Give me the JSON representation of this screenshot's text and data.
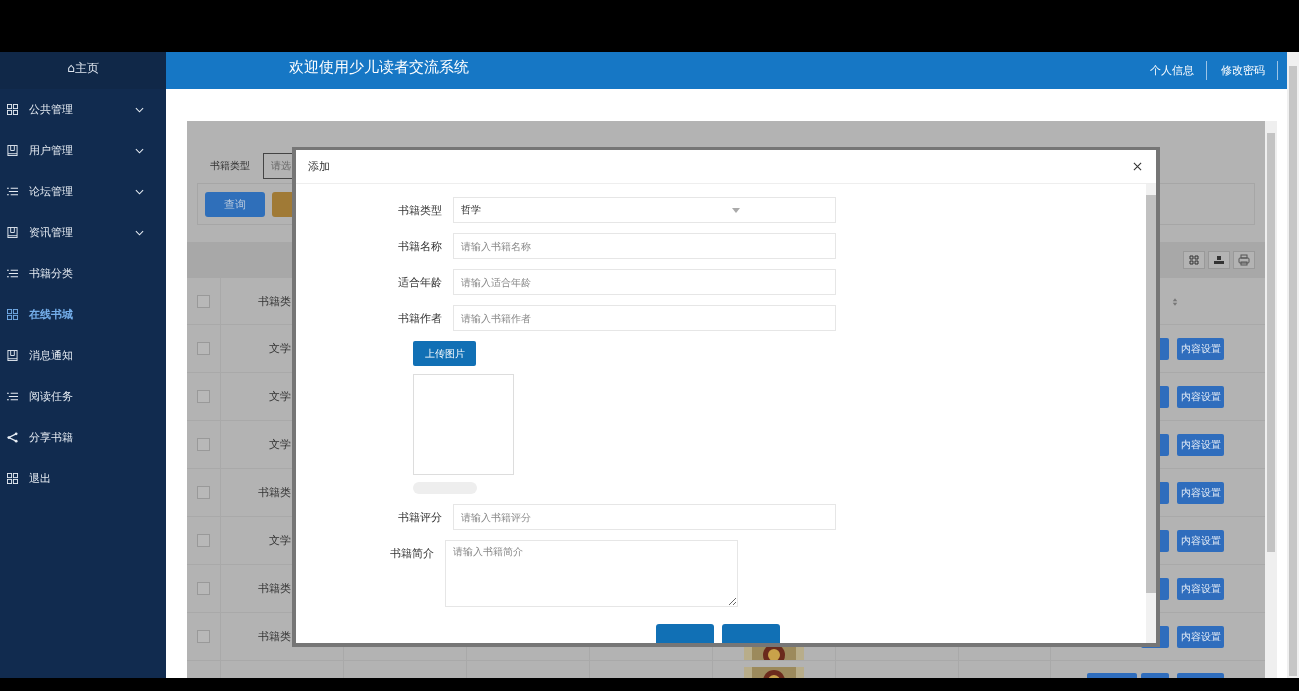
{
  "sidebar": {
    "home": "⌂主页",
    "items": [
      {
        "label": "公共管理",
        "kind": "grid",
        "has_submenu": true,
        "selected": false
      },
      {
        "label": "用户管理",
        "kind": "book",
        "has_submenu": true,
        "selected": false
      },
      {
        "label": "论坛管理",
        "kind": "list",
        "has_submenu": true,
        "selected": false
      },
      {
        "label": "资讯管理",
        "kind": "book",
        "has_submenu": true,
        "selected": false
      },
      {
        "label": "书籍分类",
        "kind": "list",
        "has_submenu": false,
        "selected": false
      },
      {
        "label": "在线书城",
        "kind": "grid",
        "has_submenu": false,
        "selected": true
      },
      {
        "label": "消息通知",
        "kind": "book",
        "has_submenu": false,
        "selected": false
      },
      {
        "label": "阅读任务",
        "kind": "list",
        "has_submenu": false,
        "selected": false
      },
      {
        "label": "分享书籍",
        "kind": "share",
        "has_submenu": false,
        "selected": false
      },
      {
        "label": "退出",
        "kind": "grid",
        "has_submenu": false,
        "selected": false
      }
    ]
  },
  "header": {
    "title": "欢迎使用少儿读者交流系统",
    "links": [
      "个人信息",
      "修改密码"
    ]
  },
  "search": {
    "label": "书籍类型",
    "placeholder": "请选",
    "query_button": "查询"
  },
  "table": {
    "columns": [
      "书籍类"
    ],
    "select_all": {
      "checked": false
    },
    "rows": [
      {
        "type": "文学",
        "action": "内容设置",
        "cover": null,
        "checked": false
      },
      {
        "type": "文学",
        "action": "内容设置",
        "cover": null,
        "checked": false
      },
      {
        "type": "文学",
        "action": "内容设置",
        "cover": null,
        "checked": false
      },
      {
        "type": "书籍类",
        "action": "内容设置",
        "cover": null,
        "checked": false
      },
      {
        "type": "文学",
        "action": "内容设置",
        "cover": null,
        "checked": false
      },
      {
        "type": "书籍类",
        "action": "内容设置",
        "cover": null,
        "checked": false
      },
      {
        "type": "书籍类",
        "action": "内容设置",
        "cover": {
          "kind": "picture"
        },
        "checked": false
      },
      {
        "cover": {
          "kind": "picture"
        }
      }
    ]
  },
  "modal": {
    "title": "添加",
    "fields": [
      {
        "label": "书籍类型",
        "kind": "select",
        "value": "哲学"
      },
      {
        "label": "书籍名称",
        "kind": "text",
        "placeholder": "请输入书籍名称"
      },
      {
        "label": "适合年龄",
        "kind": "text",
        "placeholder": "请输入适合年龄"
      },
      {
        "label": "书籍作者",
        "kind": "text",
        "placeholder": "请输入书籍作者"
      },
      {
        "kind": "upload",
        "button": "上传图片",
        "level": 0
      },
      {
        "label": "书籍评分",
        "kind": "text",
        "placeholder": "请输入书籍评分"
      },
      {
        "label": "书籍简介",
        "kind": "textarea",
        "placeholder": "请输入书籍简介"
      }
    ]
  }
}
